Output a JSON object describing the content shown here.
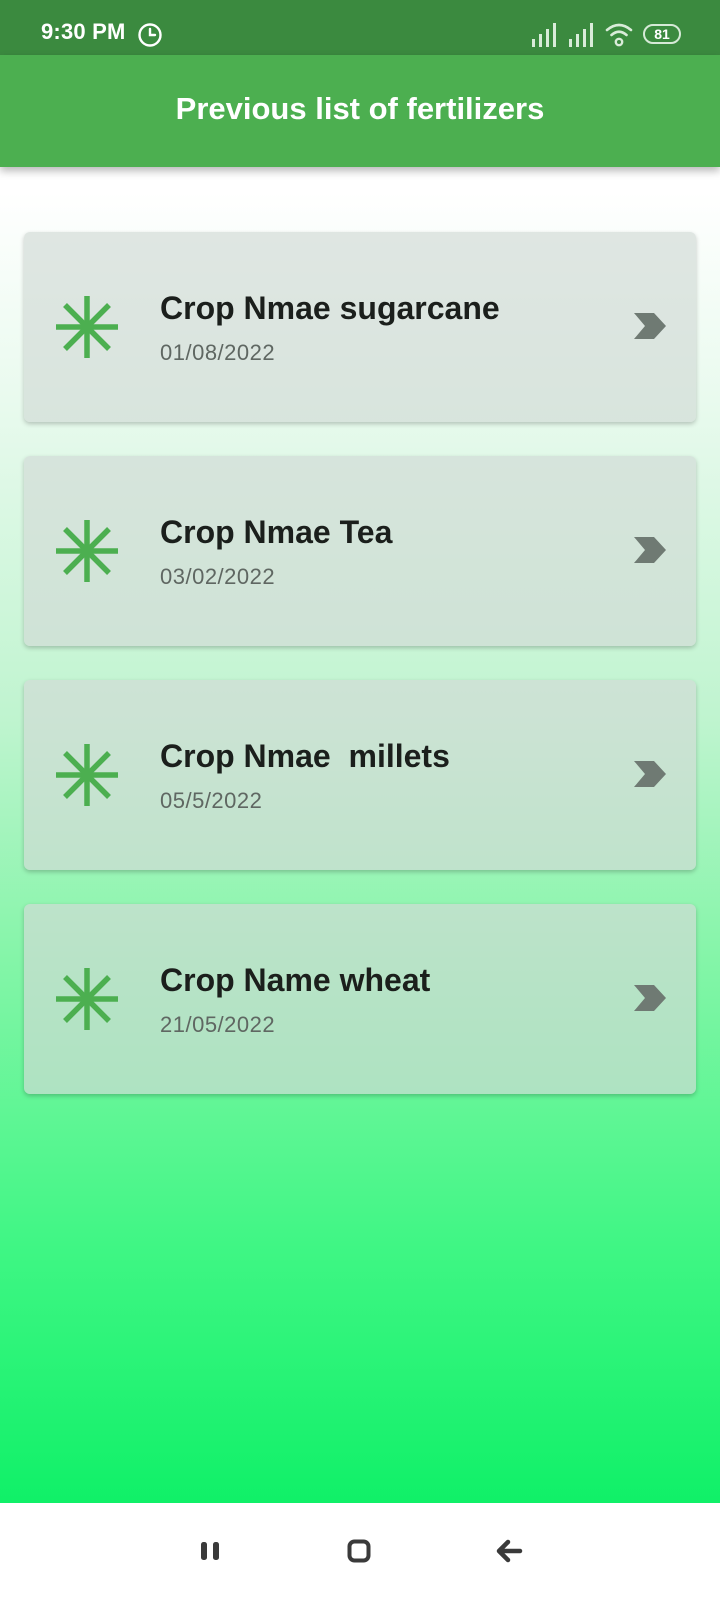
{
  "status_bar": {
    "time": "9:30 PM",
    "battery": "81",
    "icons": [
      "clock-icon",
      "signal-icon",
      "signal-icon",
      "wifi-icon",
      "battery-icon"
    ]
  },
  "app_bar": {
    "title": "Previous list of fertilizers"
  },
  "records": [
    {
      "title": "Crop Nmae sugarcane",
      "date": "01/08/2022",
      "icon": "snowflake-icon"
    },
    {
      "title": "Crop Nmae Tea",
      "date": "03/02/2022",
      "icon": "snowflake-icon"
    },
    {
      "title": "Crop Nmae  millets",
      "date": "05/5/2022",
      "icon": "snowflake-icon"
    },
    {
      "title": "Crop Name wheat",
      "date": "21/05/2022",
      "icon": "snowflake-icon"
    }
  ],
  "nav_bar": {
    "buttons": [
      "recent-apps-icon",
      "home-icon",
      "back-icon"
    ]
  },
  "colors": {
    "status_bar": "#3b8a3f",
    "app_bar": "#4caf50",
    "accent_icon": "#4caf50",
    "chevron": "#6f7a73",
    "gradient_bottom": "#07ee62"
  }
}
